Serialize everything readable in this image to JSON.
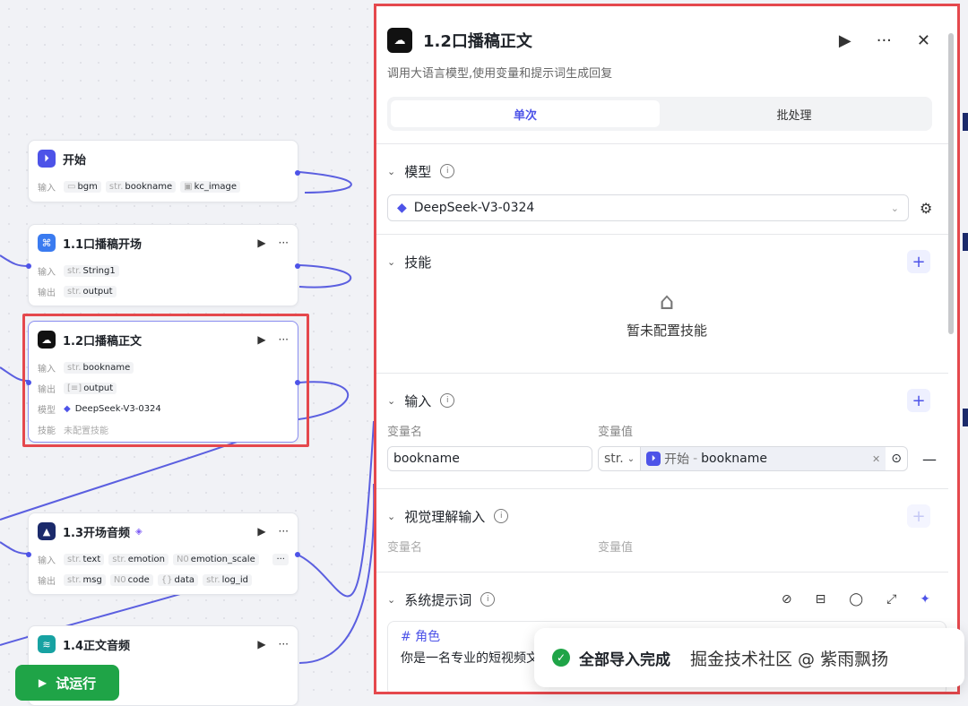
{
  "canvas": {
    "nodes": [
      {
        "title": "开始",
        "rows": [
          {
            "label": "输入",
            "tags": [
              {
                "type": "",
                "name": "bgm"
              },
              {
                "type": "str.",
                "name": "bookname"
              },
              {
                "type": "",
                "name": "kc_image"
              }
            ]
          }
        ]
      },
      {
        "title": "1.1口播稿开场",
        "rows": [
          {
            "label": "输入",
            "tags": [
              {
                "type": "str.",
                "name": "String1"
              }
            ]
          },
          {
            "label": "输出",
            "tags": [
              {
                "type": "str.",
                "name": "output"
              }
            ]
          }
        ]
      },
      {
        "title": "1.2口播稿正文",
        "rows": [
          {
            "label": "输入",
            "tags": [
              {
                "type": "str.",
                "name": "bookname"
              }
            ]
          },
          {
            "label": "输出",
            "tags": [
              {
                "type": "",
                "name": "output"
              }
            ]
          },
          {
            "label": "模型",
            "tags": [
              {
                "type": "",
                "name": "DeepSeek-V3-0324"
              }
            ]
          },
          {
            "label": "技能",
            "tags": [
              {
                "type": "",
                "name": "未配置技能"
              }
            ]
          }
        ]
      },
      {
        "title": "1.3开场音频",
        "rows": [
          {
            "label": "输入",
            "tags": [
              {
                "type": "str.",
                "name": "text"
              },
              {
                "type": "str.",
                "name": "emotion"
              },
              {
                "type": "N0",
                "name": "emotion_scale"
              }
            ]
          },
          {
            "label": "输出",
            "tags": [
              {
                "type": "str.",
                "name": "msg"
              },
              {
                "type": "N0",
                "name": "code"
              },
              {
                "type": "{}",
                "name": "data"
              },
              {
                "type": "str.",
                "name": "log_id"
              }
            ]
          }
        ]
      },
      {
        "title": "1.4正文音频",
        "rows": []
      }
    ],
    "run_button": "试运行",
    "ellipsis": "···",
    "play": "▶"
  },
  "panel": {
    "title": "1.2口播稿正文",
    "description": "调用大语言模型,使用变量和提示词生成回复",
    "tabs": [
      "单次",
      "批处理"
    ],
    "model": {
      "label": "模型",
      "value": "DeepSeek-V3-0324"
    },
    "skills": {
      "label": "技能",
      "empty": "暂未配置技能"
    },
    "input": {
      "label": "输入",
      "var_name_header": "变量名",
      "var_value_header": "变量值",
      "var_name": "bookname",
      "type": "str.",
      "ref_node": "开始",
      "ref_var": "bookname"
    },
    "vision": {
      "label": "视觉理解输入",
      "var_name_header": "变量名",
      "var_value_header": "变量值"
    },
    "system_prompt": {
      "label": "系统提示词",
      "heading": "# 角色",
      "body": "你是一名专业的短视频文"
    }
  },
  "toast": {
    "message": "全部导入完成",
    "watermark": "掘金技术社区 @ 紫雨飘扬"
  },
  "colors": {
    "accent": "#4d53e8",
    "highlight": "#e5484d",
    "run": "#1fa447"
  }
}
